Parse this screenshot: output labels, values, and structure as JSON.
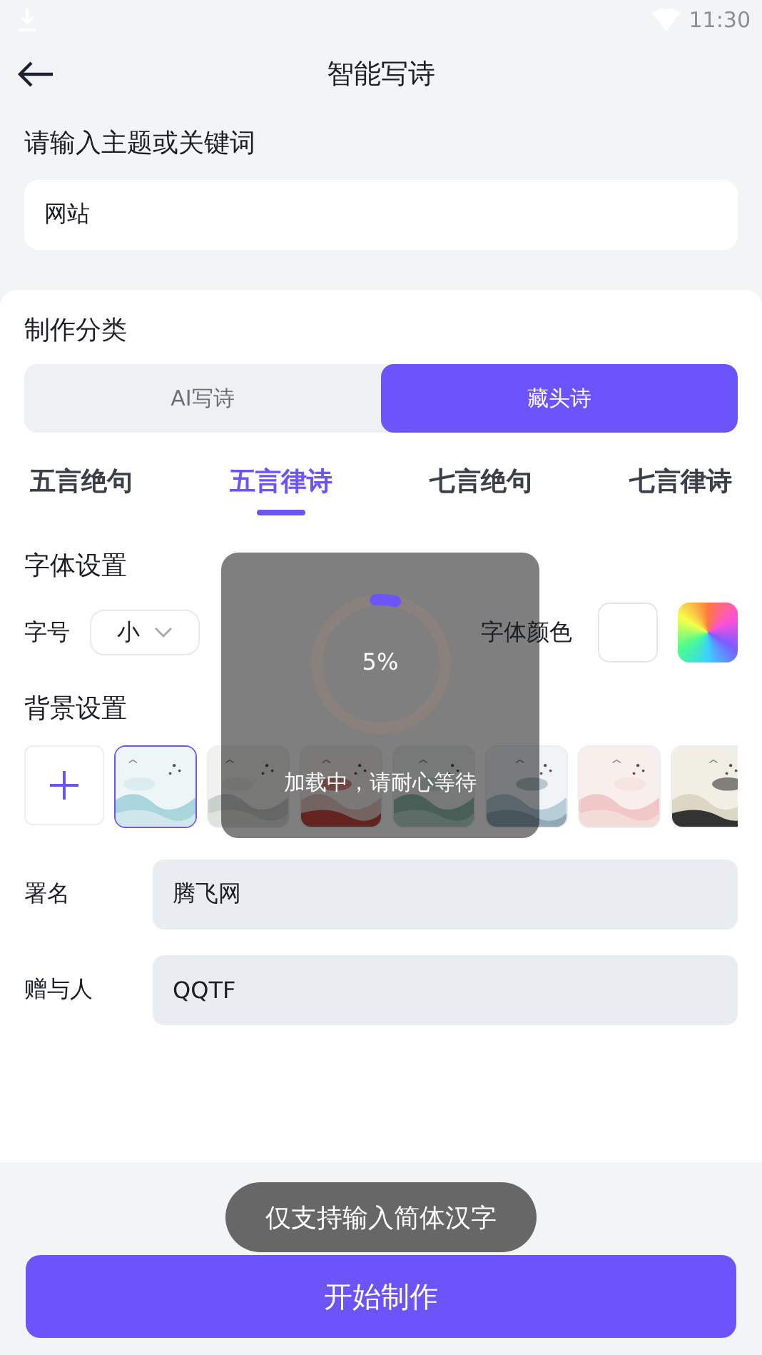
{
  "status_bar": {
    "time": "11:30"
  },
  "header": {
    "title": "智能写诗"
  },
  "topic": {
    "label": "请输入主题或关键词",
    "value": "网站"
  },
  "category": {
    "label": "制作分类",
    "modes": [
      {
        "label": "AI写诗",
        "selected": false
      },
      {
        "label": "藏头诗",
        "selected": true
      }
    ],
    "forms": [
      {
        "label": "五言绝句",
        "selected": false
      },
      {
        "label": "五言律诗",
        "selected": true
      },
      {
        "label": "七言绝句",
        "selected": false
      },
      {
        "label": "七言律诗",
        "selected": false
      }
    ]
  },
  "font": {
    "label": "字体设置",
    "size_label": "字号",
    "size_value": "小",
    "color_label": "字体颜色"
  },
  "background": {
    "label": "背景设置",
    "thumbnails": [
      {
        "kind": "picture",
        "selected": true
      },
      {
        "kind": "picture",
        "selected": false
      },
      {
        "kind": "picture",
        "selected": false
      },
      {
        "kind": "picture",
        "selected": false
      },
      {
        "kind": "picture",
        "selected": false
      },
      {
        "kind": "picture",
        "selected": false
      },
      {
        "kind": "picture",
        "selected": false
      }
    ]
  },
  "signature": {
    "label": "署名",
    "value": "腾飞网"
  },
  "recipient": {
    "label": "赠与人",
    "value": "QQTF"
  },
  "loading": {
    "percent": "5%",
    "message": "加载中，请耐心等待"
  },
  "toast": {
    "message": "仅支持输入简体汉字"
  },
  "start_button": {
    "label": "开始制作"
  }
}
